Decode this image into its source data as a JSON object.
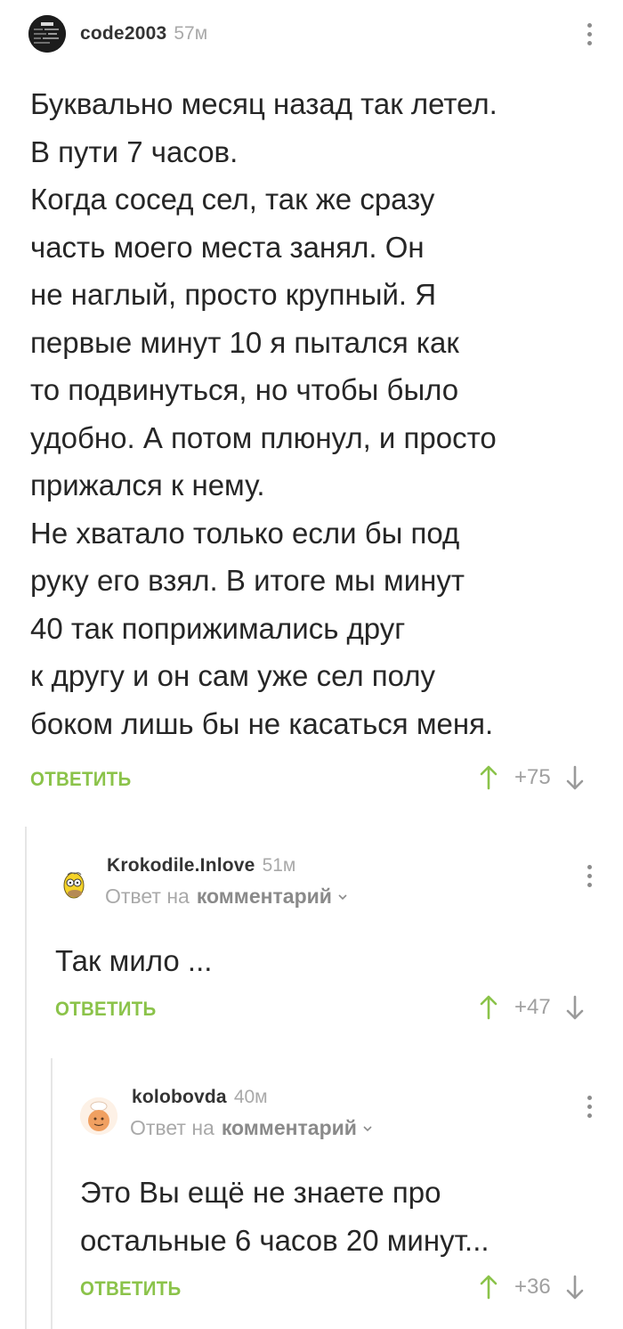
{
  "comments": [
    {
      "author": "code2003",
      "time": "57м",
      "text": "Буквально месяц назад так летел.\nВ пути 7 часов.\nКогда сосед сел, так же сразу\nчасть моего места занял. Он\nне наглый, просто крупный. Я\nпервые минут 10 я пытался как\nто подвинуться, но чтобы было\nудобно. А потом плюнул, и просто\nприжался к нему.\nНе хватало только если бы под\nруку его взял. В итоге мы минут\n40 так поприжимались друг\nк другу и он сам уже сел полу\nбоком лишь бы не касаться меня.",
      "reply_label": "ОТВЕТИТЬ",
      "rating": "+75"
    },
    {
      "author": "Krokodile.Inlove",
      "time": "51м",
      "reply_to_prefix": "Ответ на",
      "reply_to_target": "комментарий",
      "text": "Так мило ...",
      "reply_label": "ОТВЕТИТЬ",
      "rating": "+47"
    },
    {
      "author": "kolobovda",
      "time": "40м",
      "reply_to_prefix": "Ответ на",
      "reply_to_target": "комментарий",
      "text": "Это Вы ещё не знаете про\nостальные 6 часов 20 минут...",
      "reply_label": "ОТВЕТИТЬ",
      "rating": "+36"
    }
  ],
  "colors": {
    "accent_green": "#8bc34a",
    "muted_gray": "#a9a9a9",
    "text": "#262626"
  }
}
